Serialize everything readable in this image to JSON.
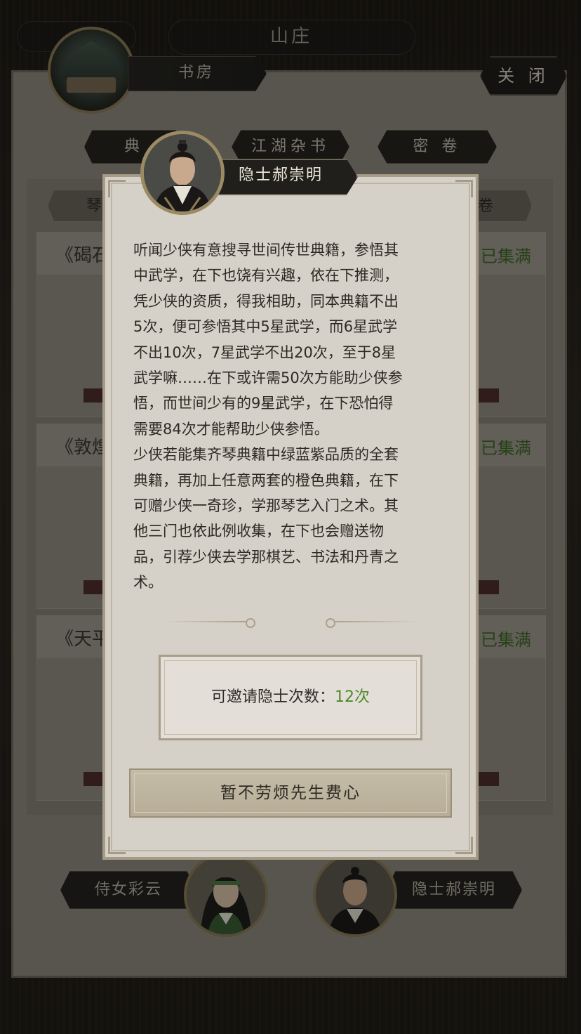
{
  "header": {
    "top_title": "山庄",
    "location_label": "书房",
    "close_label": "关 闭"
  },
  "tabs": [
    {
      "label": "典"
    },
    {
      "label": "江湖杂书"
    },
    {
      "label": "密 卷"
    }
  ],
  "subtabs": [
    {
      "label": "琴"
    },
    {
      "label": "卷"
    }
  ],
  "cards": [
    {
      "title": "《碣石",
      "status": "已集满"
    },
    {
      "title": "《敦煌",
      "status": "已集满"
    },
    {
      "title": "《天平",
      "status": "已集满"
    }
  ],
  "npcs": [
    {
      "name": "侍女彩云"
    },
    {
      "name": "隐士郝崇明"
    }
  ],
  "modal": {
    "speaker": "隐士郝崇明",
    "dialog": "听闻少侠有意搜寻世间传世典籍，参悟其\n中武学，在下也饶有兴趣，依在下推测，\n凭少侠的资质，得我相助，同本典籍不出\n5次，便可参悟其中5星武学，而6星武学\n不出10次，7星武学不出20次，至于8星\n武学嘛……在下或许需50次方能助少侠参\n悟，而世间少有的9星武学，在下恐怕得\n需要84次才能帮助少侠参悟。\n少侠若能集齐琴典籍中绿蓝紫品质的全套\n典籍，再加上任意两套的橙色典籍，在下\n可赠少侠一奇珍，学那琴艺入门之术。其\n他三门也依此例收集，在下也会赠送物\n品，引荐少侠去学那棋艺、书法和丹青之\n术。",
    "invite_label": "可邀请隐士次数：",
    "invite_value": "12次",
    "decline_label": "暂不劳烦先生费心"
  },
  "colors": {
    "accent_green": "#4e8a2c",
    "modal_bg": "#d6d1c8",
    "plate_dark": "#211f1c"
  },
  "icons": {
    "shop": "pavilion-icon",
    "portrait": "hermit-portrait",
    "maid": "maid-portrait"
  }
}
